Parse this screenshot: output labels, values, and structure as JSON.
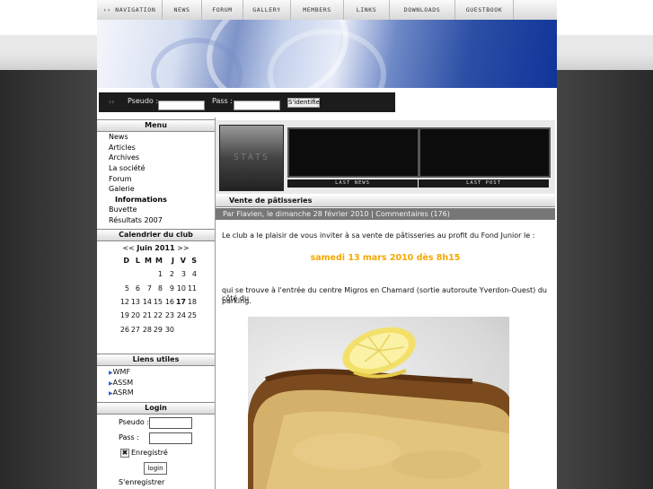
{
  "nav": {
    "items": [
      "›› NAVIGATION",
      "NEWS",
      "FORUM",
      "GALLERY",
      "MEMBERS",
      "LINKS",
      "DOWNLOADS",
      "GUESTBOOK"
    ]
  },
  "login_bar": {
    "arrows": "››",
    "pseudo_label": "Pseudo :",
    "pass_label": "Pass :",
    "submit_label": "S'identifier"
  },
  "sidebar": {
    "menu_title": "Menu",
    "menu_items": [
      "News",
      "Articles",
      "Archives",
      "La société",
      "Forum",
      "Galerie",
      "Informations",
      "Buvette",
      "Résultats 2007"
    ],
    "calendar_title": "Calendrier du club",
    "calendar": {
      "prev": "<<",
      "month": "Juin 2011",
      "next": ">>",
      "weekdays": [
        "D",
        "L",
        "M",
        "M",
        "J",
        "V",
        "S"
      ],
      "weeks": [
        [
          "",
          "",
          "",
          "1",
          "2",
          "3",
          "4"
        ],
        [
          "5",
          "6",
          "7",
          "8",
          "9",
          "10",
          "11"
        ],
        [
          "12",
          "13",
          "14",
          "15",
          "16",
          "17",
          "18"
        ],
        [
          "19",
          "20",
          "21",
          "22",
          "23",
          "24",
          "25"
        ],
        [
          "26",
          "27",
          "28",
          "29",
          "30",
          "",
          ""
        ]
      ],
      "today": "17"
    },
    "links_title": "Liens utiles",
    "links": [
      "WMF",
      "ASSM",
      "ASRM"
    ],
    "login_title": "Login",
    "login": {
      "pseudo_label": "Pseudo :",
      "pass_label": "Pass :",
      "remember_label": "Enregistré",
      "remember_checked": true,
      "button_label": "login",
      "register_label": "S'enregistrer"
    }
  },
  "stats": {
    "logo_text": "STATS",
    "last_news_label": "LAST NEWS",
    "last_post_label": "LAST POST"
  },
  "article": {
    "title": "Vente de pâtisseries",
    "meta": "Par Flavien, le dimanche 28 février 2010 | Commentaires (176)",
    "intro": "Le club a le plaisir de vous inviter à sa vente de pâtisseries au profit du Fond Junior le :",
    "date_highlight": "samedi 13 mars 2010 dès 8h15",
    "location_line1": "qui se trouve à l'entrée du centre Migros en Chamard (sortie autoroute Yverdon-Ouest) du côté du",
    "location_line2": "parking."
  },
  "colors": {
    "highlight": "#f5a800",
    "banner_blue": "#2c4fa5",
    "meta_bar": "#777777"
  }
}
